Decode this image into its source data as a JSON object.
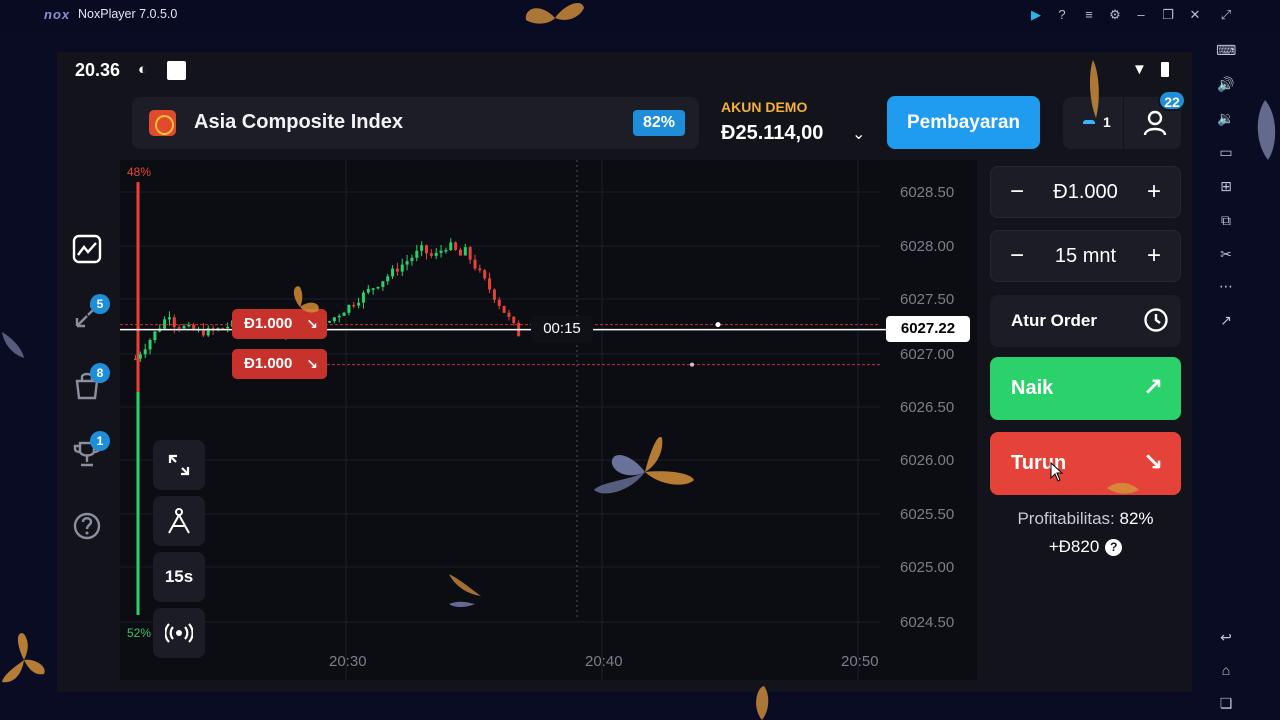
{
  "emulator": {
    "logo": "nox",
    "title": "NoxPlayer 7.0.5.0"
  },
  "status_bar": {
    "time": "20.36"
  },
  "asset": {
    "name": "Asia Composite Index",
    "payout_badge": "82%"
  },
  "account": {
    "label": "AKUN DEMO",
    "balance": "Đ25.114,00"
  },
  "header": {
    "payment_button": "Pembayaran",
    "trades_count": "1",
    "notifications_badge": "22"
  },
  "left_nav": {
    "trades_badge": "5",
    "market_badge": "8",
    "achievements_badge": "1"
  },
  "chart": {
    "sentiment_up": "48%",
    "sentiment_down": "52%",
    "price_labels": [
      "6028.50",
      "6028.00",
      "6027.50",
      "6027.00",
      "6026.50",
      "6026.00",
      "6025.50",
      "6025.00",
      "6024.50"
    ],
    "time_labels": [
      "20:30",
      "20:40",
      "20:50"
    ],
    "current_price": "6027.22",
    "countdown": "00:15",
    "deals": [
      {
        "amount": "Đ1.000",
        "direction": "down"
      },
      {
        "amount": "Đ1.000",
        "direction": "down"
      }
    ],
    "timeframe": "15s"
  },
  "chart_data": {
    "type": "candlestick",
    "title": "",
    "ylim": [
      6024.35,
      6028.62
    ],
    "y_ticks": [
      6028.5,
      6028.0,
      6027.5,
      6027.0,
      6026.5,
      6026.0,
      6025.5,
      6025.0,
      6024.5
    ],
    "x_ticks": [
      "20:30",
      "20:40",
      "20:50"
    ],
    "current_price": 6027.22,
    "grid": true
  },
  "panel": {
    "amount": "Đ1.000",
    "duration": "15 mnt",
    "order_button": "Atur Order",
    "up_button": "Naik",
    "down_button": "Turun",
    "profitability_label": "Profitabilitas:",
    "profitability_value": "82%",
    "payout": "+Đ820"
  },
  "colors": {
    "up": "#2bd16b",
    "down": "#e5433a",
    "accent": "#1f9cf0",
    "demo_label": "#f4b13a"
  }
}
